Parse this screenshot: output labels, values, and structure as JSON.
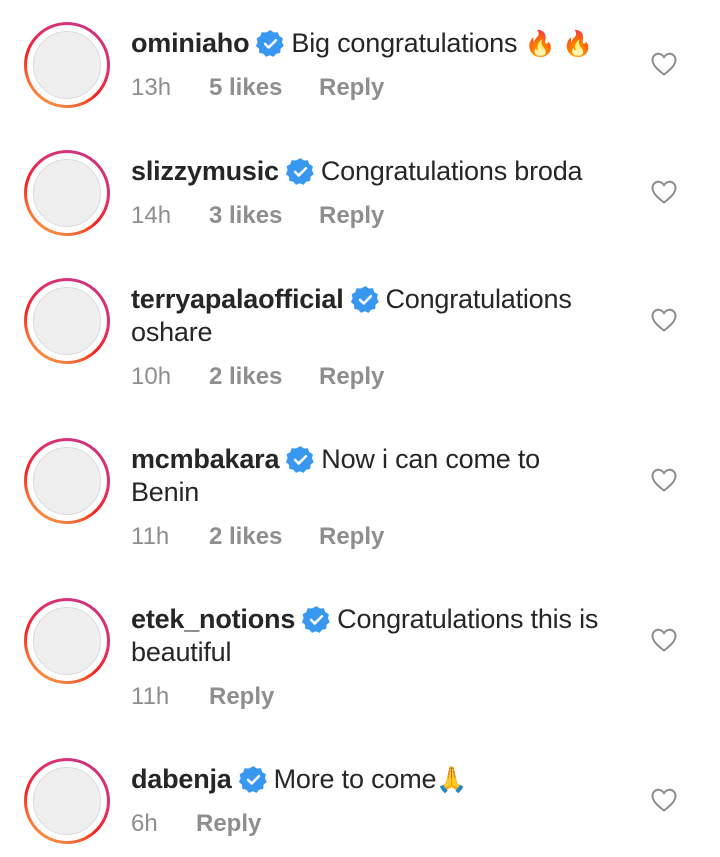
{
  "comments": [
    {
      "username": "ominiaho",
      "text": "Big congratulations",
      "emoji": "🔥 🔥",
      "time": "13h",
      "likes": "5 likes",
      "reply": "Reply"
    },
    {
      "username": "slizzymusic",
      "text": "Congratulations broda",
      "time": "14h",
      "likes": "3 likes",
      "reply": "Reply"
    },
    {
      "username": "terryapalaofficial",
      "text": "Congratulations oshare",
      "time": "10h",
      "likes": "2 likes",
      "reply": "Reply"
    },
    {
      "username": "mcmbakara",
      "text": "Now i can come to Benin",
      "time": "11h",
      "likes": "2 likes",
      "reply": "Reply"
    },
    {
      "username": "etek_notions",
      "text": "Congratulations this is beautiful",
      "time": "11h",
      "reply": "Reply"
    },
    {
      "username": "dabenja",
      "text": "More to come",
      "emoji": "🙏",
      "time": "6h",
      "reply": "Reply"
    }
  ],
  "colors": {
    "text": "#262626",
    "meta": "#8e8e8e",
    "verified": "#3897f0"
  },
  "icons": {
    "verified": "verified-badge-icon",
    "like": "heart-outline-icon"
  }
}
